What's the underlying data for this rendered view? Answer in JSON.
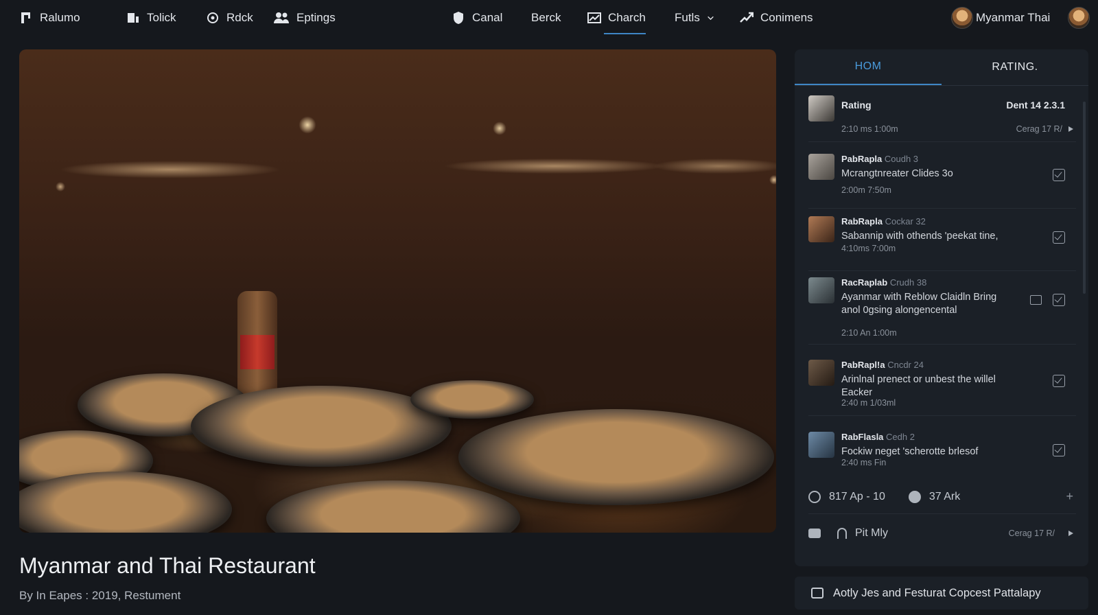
{
  "nav": {
    "brand": "Ralumo",
    "items": [
      {
        "label": "Tolick",
        "icon": "chart-icon"
      },
      {
        "label": "Rdck",
        "icon": "badge-icon"
      },
      {
        "label": "Eptings",
        "icon": "users-icon"
      },
      {
        "label": "Canal",
        "icon": "shield-icon"
      },
      {
        "label": "Berck",
        "icon": ""
      },
      {
        "label": "Charch",
        "icon": "line-chart-icon",
        "active": true
      },
      {
        "label": "Futls",
        "icon": "chevron-down-icon"
      },
      {
        "label": "Conimens",
        "icon": "trend-icon"
      }
    ],
    "user_name": "Myanmar Thai"
  },
  "hero": {
    "title": "Myanmar and Thai Restaurant",
    "byline": "By  In Eapes : 2019, Restument"
  },
  "panel": {
    "tabs": [
      "HOM",
      "RATING."
    ],
    "header_row": {
      "title": "Rating",
      "date": "Dent 14 2.3.1",
      "meta_left": "2:10 ms   1:00m",
      "meta_right": "Cerag 17 R/"
    },
    "comments": [
      {
        "name": "PabRapla",
        "sub": "Coudh 3",
        "text": "Mcrangtnreater Clides 3o",
        "meta": "2:00m   7:50m",
        "bubble": false
      },
      {
        "name": "RabRapla",
        "sub": "Cockar 32",
        "text": "Sabannip with othends 'peekat tine,",
        "meta": "4:10ms   7:00m",
        "bubble": false
      },
      {
        "name": "RacRaplab",
        "sub": "Crudh 38",
        "text": "Ayanmar with Reblow Claidln Bring anol 0gsing alongencental",
        "meta": "2:10 An   1:00m",
        "bubble": true
      },
      {
        "name": "PabRapl!a",
        "sub": "Cncdr 24",
        "text": "Arinlnal prenect or unbest the willel Eacker",
        "meta": "2:40 m   1/03ml",
        "bubble": false
      },
      {
        "name": "RabFlasla",
        "sub": "Cedh 2",
        "text": "Fockiw neget 'scherotte brlesof",
        "meta": "2:40 ms   Fin",
        "bubble": false
      }
    ],
    "stats": {
      "views": "817 Ap - 10",
      "comments": "37 Ark"
    },
    "player": {
      "label": "Pit Mly",
      "right": "Cerag 17 R/"
    }
  },
  "footer_bar": {
    "label": "Aotly Jes and Festurat Copcest Pattalapy"
  }
}
